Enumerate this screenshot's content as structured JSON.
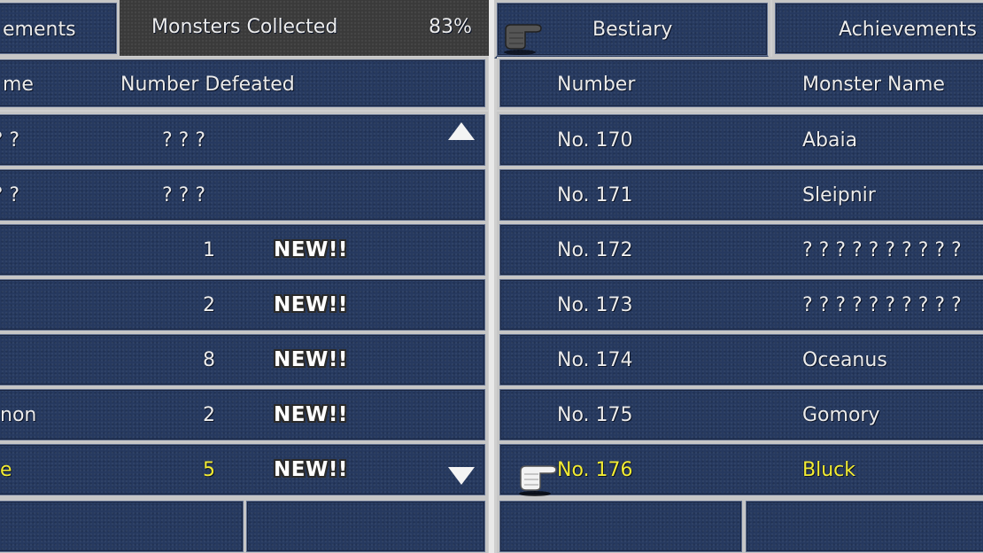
{
  "left_panel": {
    "tab_achievements_label": "ements",
    "collected_label": "Monsters Collected",
    "collected_percent": "83%",
    "header": {
      "name_col": "me",
      "defeated_col": "Number Defeated"
    },
    "rows": [
      {
        "name": "? ? ?",
        "defeated": "? ? ?",
        "badge": ""
      },
      {
        "name": "? ? ?",
        "defeated": "? ? ?",
        "badge": ""
      },
      {
        "name": "",
        "defeated": "1",
        "badge": "NEW!!"
      },
      {
        "name": "",
        "defeated": "2",
        "badge": "NEW!!"
      },
      {
        "name": "",
        "defeated": "8",
        "badge": "NEW!!"
      },
      {
        "name": "non",
        "defeated": "2",
        "badge": "NEW!!"
      },
      {
        "name": "e",
        "defeated": "5",
        "badge": "NEW!!"
      }
    ]
  },
  "right_panel": {
    "tab_bestiary_label": "Bestiary",
    "tab_achievements_label": "Achievements",
    "header": {
      "number_col": "Number",
      "name_col": "Monster Name"
    },
    "rows": [
      {
        "number": "No. 170",
        "name": "Abaia"
      },
      {
        "number": "No. 171",
        "name": "Sleipnir"
      },
      {
        "number": "No. 172",
        "name": "? ? ? ? ? ? ? ? ? ?"
      },
      {
        "number": "No. 173",
        "name": "? ? ? ? ? ? ? ? ? ?"
      },
      {
        "number": "No. 174",
        "name": "Oceanus"
      },
      {
        "number": "No. 175",
        "name": "Gomory"
      },
      {
        "number": "No. 176",
        "name": "Bluck"
      }
    ]
  },
  "icons": {
    "scroll_up": "triangle-up",
    "scroll_down": "triangle-down",
    "cursor": "pointing-hand"
  },
  "colors": {
    "panel_blue": "#26395f",
    "border": "#c6c6c6",
    "text": "#ececec",
    "selected_text": "#f3ec33"
  }
}
